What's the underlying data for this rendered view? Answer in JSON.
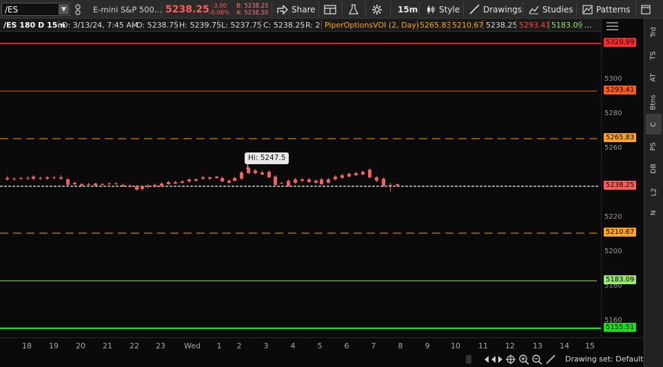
{
  "toolbar": {
    "symbol": "/ES",
    "description": "E-mini S&P 500...",
    "last_price": "5238.25",
    "net_change": "-3.00",
    "pct_change": "-0.06%",
    "bid": "B: 5238.25",
    "ask": "A: 5238.50",
    "share_label": "Share",
    "timeframe_label": "15m",
    "style_label": "Style",
    "drawings_label": "Drawings",
    "studies_label": "Studies",
    "patterns_label": "Patterns"
  },
  "infobar": {
    "chart_id": "/ES 180 D 15m",
    "date": "D: 3/13/24, 7:45 AM",
    "open": "O: 5238.75",
    "high": "H: 5239.75",
    "low": "L: 5237.75",
    "close": "C: 5238.25",
    "range": "R: 2",
    "study_name": "PiperOptionsVOI (2, Day)",
    "study_values": [
      "5265.83",
      "5210.67",
      "5238.25",
      "5293.41",
      "5183.09"
    ],
    "more": "..."
  },
  "y_axis": {
    "ticks": [
      "5300",
      "5280",
      "5260",
      "5220",
      "5200",
      "5180",
      "5160"
    ]
  },
  "level_tags": [
    {
      "value": "5320.99",
      "color": "#ff2a2a"
    },
    {
      "value": "5293.41",
      "color": "#ff5a1f"
    },
    {
      "value": "5265.83",
      "color": "#ffa51f"
    },
    {
      "value": "5238.25",
      "color": "#ff5c5c"
    },
    {
      "value": "5210.67",
      "color": "#ffa51f"
    },
    {
      "value": "5183.09",
      "color": "#9be86e"
    },
    {
      "value": "5155.51",
      "color": "#16e316"
    }
  ],
  "hi_label": "Hi: 5247.5",
  "x_axis": {
    "labels": [
      "18",
      "19",
      "20",
      "21",
      "22",
      "23",
      "Wed",
      "1",
      "2",
      "3",
      "4",
      "5",
      "6",
      "7",
      "8",
      "9",
      "10",
      "11",
      "12",
      "13",
      "14",
      "15"
    ]
  },
  "sidebar": {
    "items": [
      "Trd",
      "TS",
      "AT",
      "Btns",
      "C",
      "PS",
      "DB",
      "L2",
      "N"
    ],
    "active": "C"
  },
  "bottom": {
    "drawing_set": "Drawing set: Default"
  },
  "colors": {
    "up_candle": "#5fa8e8",
    "down_candle": "#f06060",
    "bg": "#0a0a0a"
  }
}
